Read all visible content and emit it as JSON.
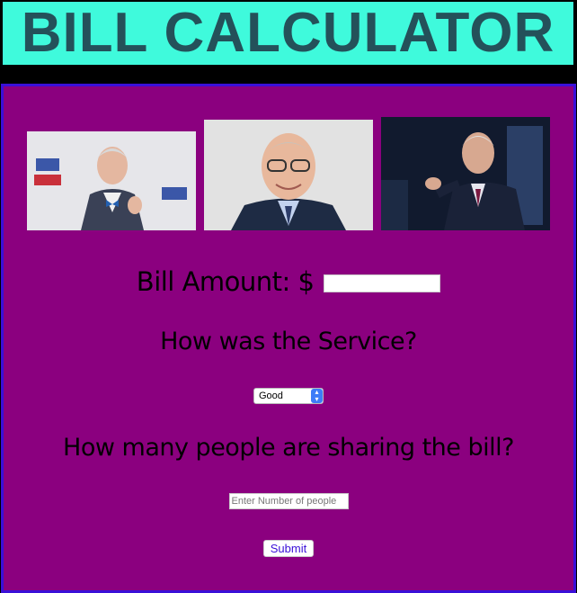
{
  "header": {
    "title": "BILL CALCULATOR"
  },
  "photos": [
    {
      "name": "photo-1"
    },
    {
      "name": "photo-2"
    },
    {
      "name": "photo-3"
    }
  ],
  "form": {
    "bill_label": "Bill Amount: $",
    "bill_value": "",
    "service_question": "How was the Service?",
    "service_selected": "Good",
    "people_question": "How many people are sharing the bill?",
    "people_placeholder": "Enter Number of people",
    "submit_label": "Submit"
  },
  "colors": {
    "banner": "#3ffadc",
    "banner_text": "#24515a",
    "panel": "#8b007f",
    "panel_border": "#3a10d8",
    "page_background": "#000000"
  }
}
